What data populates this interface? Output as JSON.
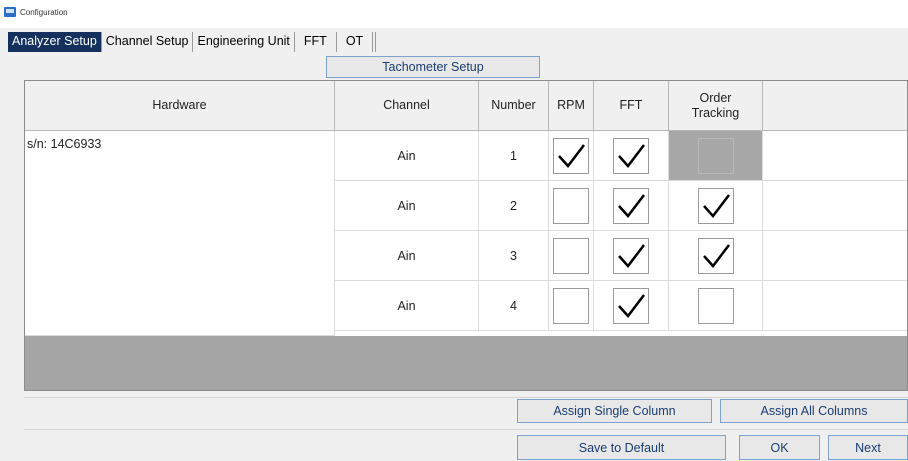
{
  "window": {
    "title": "Configuration"
  },
  "tabs": [
    "Analyzer Setup",
    "Channel Setup",
    "Engineering Unit",
    "FFT",
    "OT",
    ""
  ],
  "tachometer_button": "Tachometer Setup",
  "table": {
    "headers": {
      "hardware": "Hardware",
      "channel": "Channel",
      "number": "Number",
      "rpm": "RPM",
      "fft": "FFT",
      "order_tracking": "Order Tracking"
    },
    "hardware_serial": "s/n: 14C6933",
    "rows": [
      {
        "channel": "Ain",
        "number": "1",
        "rpm": true,
        "fft": true,
        "ot": false,
        "ot_disabled": true
      },
      {
        "channel": "Ain",
        "number": "2",
        "rpm": false,
        "fft": true,
        "ot": true,
        "ot_disabled": false
      },
      {
        "channel": "Ain",
        "number": "3",
        "rpm": false,
        "fft": true,
        "ot": true,
        "ot_disabled": false
      },
      {
        "channel": "Ain",
        "number": "4",
        "rpm": false,
        "fft": true,
        "ot": false,
        "ot_disabled": false
      }
    ]
  },
  "buttons": {
    "assign_single": "Assign Single Column",
    "assign_all": "Assign All Columns",
    "save_default": "Save to Default",
    "ok": "OK",
    "next": "Next"
  },
  "colors": {
    "active_tab": "#14315e",
    "button_border": "#7da2ce",
    "disabled_cell": "#a7a7a7"
  }
}
